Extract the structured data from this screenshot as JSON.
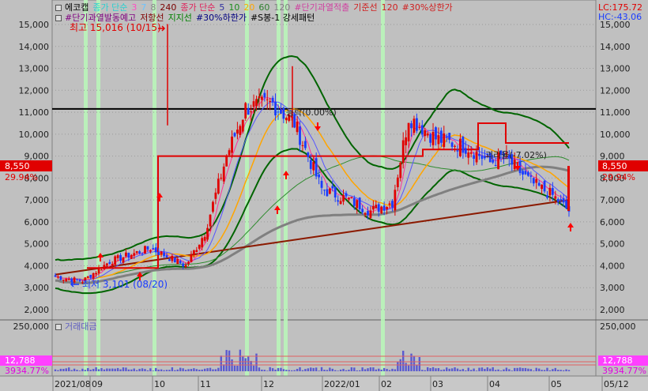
{
  "legend": {
    "row1": [
      {
        "text": "에코캡",
        "color": "#000000"
      },
      {
        "text": "종가 단순",
        "color": "#2ad0d0"
      },
      {
        "text": "3",
        "color": "#ff4ec3"
      },
      {
        "text": "7",
        "color": "#6cc3ff"
      },
      {
        "text": "8",
        "color": "#8a8a8a"
      },
      {
        "text": "240",
        "color": "#7a0000"
      },
      {
        "text": "종가 단순",
        "color": "#e0205a"
      },
      {
        "text": "5",
        "color": "#3030a0"
      },
      {
        "text": "10",
        "color": "#1c8c1c"
      },
      {
        "text": "20",
        "color": "#ffa500"
      },
      {
        "text": "60",
        "color": "#2f7f2f"
      },
      {
        "text": "120",
        "color": "#808080"
      },
      {
        "text": "#단기과열적출",
        "color": "#d040a0"
      },
      {
        "text": "기준선",
        "color": "#d02020"
      },
      {
        "text": "120",
        "color": "#d02020"
      },
      {
        "text": "#30%상한가",
        "color": "#d02020"
      }
    ],
    "row2": [
      {
        "text": "#단기과열발동예고",
        "color": "#800080"
      },
      {
        "text": "저항선",
        "color": "#800000"
      },
      {
        "text": "지지선",
        "color": "#008000"
      },
      {
        "text": "#30%하한가",
        "color": "#000080"
      },
      {
        "text": "#S봉-1 강세패턴",
        "color": "#000000"
      }
    ],
    "volume": "거래대금"
  },
  "readouts": {
    "lc": "LC:175.72",
    "hc": "HC:-43.06",
    "price_box": "8,550",
    "price_pct": "29.94%",
    "vol_box": "12,788",
    "vol_pct": "3934.77%"
  },
  "annotations": {
    "high": "최고 15,016 (10/15)",
    "low": "최저 3,101 (08/20)",
    "rise": "등락(0.00%)",
    "fall": "괴리율(-7.02%)"
  },
  "colors": {
    "up": "#e00000",
    "down": "#1a3cff",
    "bg": "#c0c0c0",
    "ma5": "#ff3399",
    "ma10": "#5555ff",
    "ma20": "#ffa500",
    "ma60": "#2e8b2e",
    "ma120": "#808080",
    "ma240": "#8b1a00",
    "band": "#006400",
    "resist": "#e00000",
    "highlight": "#b9f5b9"
  },
  "chart_data": {
    "type": "candlestick",
    "price_axis": {
      "ticks": [
        2000,
        3000,
        4000,
        5000,
        6000,
        7000,
        8000,
        9000,
        10000,
        11000,
        12000,
        13000,
        14000,
        15000
      ]
    },
    "volume_axis": {
      "ticks": [
        0,
        50000,
        100000,
        150000,
        200000,
        250000
      ]
    },
    "x_labels": [
      "2021/08",
      "09",
      "10",
      "11",
      "12",
      "2022/01",
      "02",
      "03",
      "04",
      "05",
      "05/12"
    ],
    "current_price": 8550,
    "reference_line": 11150,
    "high": {
      "value": 15016,
      "date": "10/15"
    },
    "low": {
      "value": 3101,
      "date": "08/20"
    }
  }
}
